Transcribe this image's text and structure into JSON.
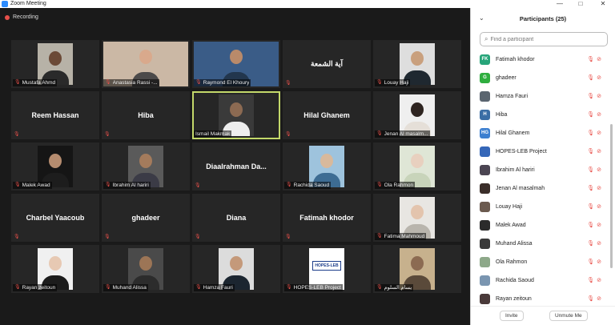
{
  "window": {
    "title": "Zoom Meeting",
    "minimize": "—",
    "maximize": "□",
    "close": "✕"
  },
  "meeting": {
    "recording_label": "Recording"
  },
  "tiles": [
    {
      "name": "Mustafa Ahmd",
      "big": "",
      "type": "photo",
      "skin": "#6b4a37",
      "shirt": "#2a2a2a",
      "bg": "#b7b2a7"
    },
    {
      "name": "Anastasia Rassi -...",
      "big": "",
      "type": "wide",
      "skin": "#d9a98c",
      "shirt": "#4c4a4a",
      "bg": "#cbb8a5"
    },
    {
      "name": "Raymond El Khoury",
      "big": "",
      "type": "wide",
      "skin": "#b98a6a",
      "shirt": "#22364d",
      "bg": "#3a5c87"
    },
    {
      "name": "",
      "big": "آية الشمعة",
      "type": "text"
    },
    {
      "name": "Louay Haji",
      "big": "",
      "type": "photo",
      "skin": "#c9a07e",
      "shirt": "#1f2830",
      "bg": "#dedede"
    },
    {
      "name": "",
      "big": "Reem Hassan",
      "type": "text"
    },
    {
      "name": "",
      "big": "Hiba",
      "type": "text"
    },
    {
      "name": "Ismail Makmak",
      "big": "",
      "type": "photo",
      "skin": "#8c6a52",
      "shirt": "#eeeeee",
      "bg": "#3a3a3a",
      "active": true,
      "nomic": true
    },
    {
      "name": "",
      "big": "Hilal Ghanem",
      "type": "text"
    },
    {
      "name": "Jenan Al masalm...",
      "big": "",
      "type": "photo",
      "skin": "#2e2420",
      "shirt": "#e5dfd8",
      "bg": "#efefef"
    },
    {
      "name": "Malek Awad",
      "big": "",
      "type": "photo",
      "skin": "#b58c6f",
      "shirt": "#1d1d1d",
      "bg": "#151515"
    },
    {
      "name": "Ibrahim Al hariri",
      "big": "",
      "type": "photo",
      "skin": "#a47b5c",
      "shirt": "#3b3b46",
      "bg": "#5a5a5a"
    },
    {
      "name": "",
      "big": "Diaalrahman  Da...",
      "type": "text"
    },
    {
      "name": "Rachida Saoud",
      "big": "",
      "type": "photo",
      "skin": "#d8b99c",
      "shirt": "#3d6c93",
      "bg": "#9ec3dd"
    },
    {
      "name": "Ola Rahmon",
      "big": "",
      "type": "photo",
      "skin": "#e8d0bf",
      "shirt": "#c8d4ba",
      "bg": "#dfe6d6"
    },
    {
      "name": "",
      "big": "Charbel Yaacoub",
      "type": "text"
    },
    {
      "name": "",
      "big": "ghadeer",
      "type": "text"
    },
    {
      "name": "",
      "big": "Diana",
      "type": "text"
    },
    {
      "name": "",
      "big": "Fatimah khodor",
      "type": "text"
    },
    {
      "name": "Fatima Mahmoud",
      "big": "",
      "type": "photo",
      "skin": "#e3c4ad",
      "shirt": "#b9b5ad",
      "bg": "#e8e6e2"
    },
    {
      "name": "Rayan zeitoun",
      "big": "",
      "type": "photo",
      "skin": "#e7c9b3",
      "shirt": "#1c1c1c",
      "bg": "#f0f0f0"
    },
    {
      "name": "Muhand Alissa",
      "big": "",
      "type": "photo",
      "skin": "#9c7556",
      "shirt": "#2c2c2c",
      "bg": "#4a4a4a"
    },
    {
      "name": "Hamza Fauri",
      "big": "",
      "type": "photo",
      "skin": "#c4997a",
      "shirt": "#1b2530",
      "bg": "#dcdcdc"
    },
    {
      "name": "HOPES-LEB Project",
      "big": "",
      "type": "logo",
      "logo": "HOPES-LEB"
    },
    {
      "name": "يسام السلوم",
      "big": "",
      "type": "photo",
      "skin": "#8c6b52",
      "shirt": "#5a4a3a",
      "bg": "#c7b18d"
    }
  ],
  "participants_panel": {
    "title": "Participants (25)",
    "search_placeholder": "Find a participant",
    "invite_label": "Invite",
    "unmute_label": "Unmute Me",
    "items": [
      {
        "name": "Fatimah khodor",
        "initials": "FK",
        "color": "#27a57a"
      },
      {
        "name": "ghadeer",
        "initials": "G",
        "color": "#2fae3f"
      },
      {
        "name": "Hamza Fauri",
        "initials": "",
        "color": "#5a6570"
      },
      {
        "name": "Hiba",
        "initials": "H",
        "color": "#3a6ea5"
      },
      {
        "name": "Hilal Ghanem",
        "initials": "HG",
        "color": "#3c7fd0"
      },
      {
        "name": "HOPES-LEB Project",
        "initials": "",
        "color": "#3567b8"
      },
      {
        "name": "Ibrahim Al hariri",
        "initials": "",
        "color": "#4b4552"
      },
      {
        "name": "Jenan Al masalmah",
        "initials": "",
        "color": "#3b2e2a"
      },
      {
        "name": "Louay Haji",
        "initials": "",
        "color": "#6b5a4f"
      },
      {
        "name": "Malek Awad",
        "initials": "",
        "color": "#2b2b2b"
      },
      {
        "name": "Muhand Alissa",
        "initials": "",
        "color": "#3a3a3a"
      },
      {
        "name": "Ola Rahmon",
        "initials": "",
        "color": "#8da889"
      },
      {
        "name": "Rachida Saoud",
        "initials": "",
        "color": "#7a95b0"
      },
      {
        "name": "Rayan zeitoun",
        "initials": "",
        "color": "#4a3a3a"
      }
    ]
  }
}
